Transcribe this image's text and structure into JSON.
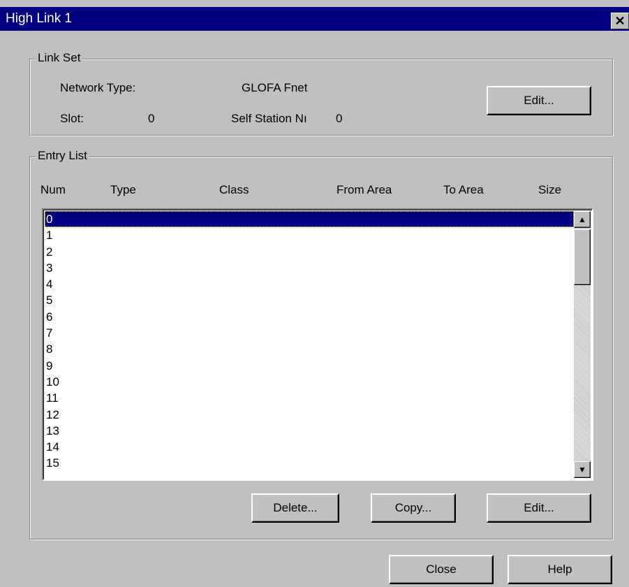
{
  "window": {
    "title": "High Link 1",
    "close_glyph": "✕"
  },
  "link_set": {
    "label": "Link Set",
    "network_type_label": "Network Type:",
    "network_type_value": "GLOFA Fnet",
    "slot_label": "Slot:",
    "slot_value": "0",
    "self_station_label": "Self Station Nı",
    "self_station_value": "0",
    "edit_button": "Edit..."
  },
  "entry_list": {
    "label": "Entry List",
    "columns": [
      "Num",
      "Type",
      "Class",
      "From Area",
      "To Area",
      "Size"
    ],
    "rows": [
      "0",
      "1",
      "2",
      "3",
      "4",
      "5",
      "6",
      "7",
      "8",
      "9",
      "10",
      "11",
      "12",
      "13",
      "14",
      "15"
    ],
    "selected_index": 0,
    "delete_button": "Delete...",
    "copy_button": "Copy...",
    "edit_button": "Edit..."
  },
  "footer": {
    "close_button": "Close",
    "help_button": "Help"
  },
  "colors": {
    "title_bar": "#000080",
    "face": "#c0c0c0",
    "selection": "#000080"
  }
}
